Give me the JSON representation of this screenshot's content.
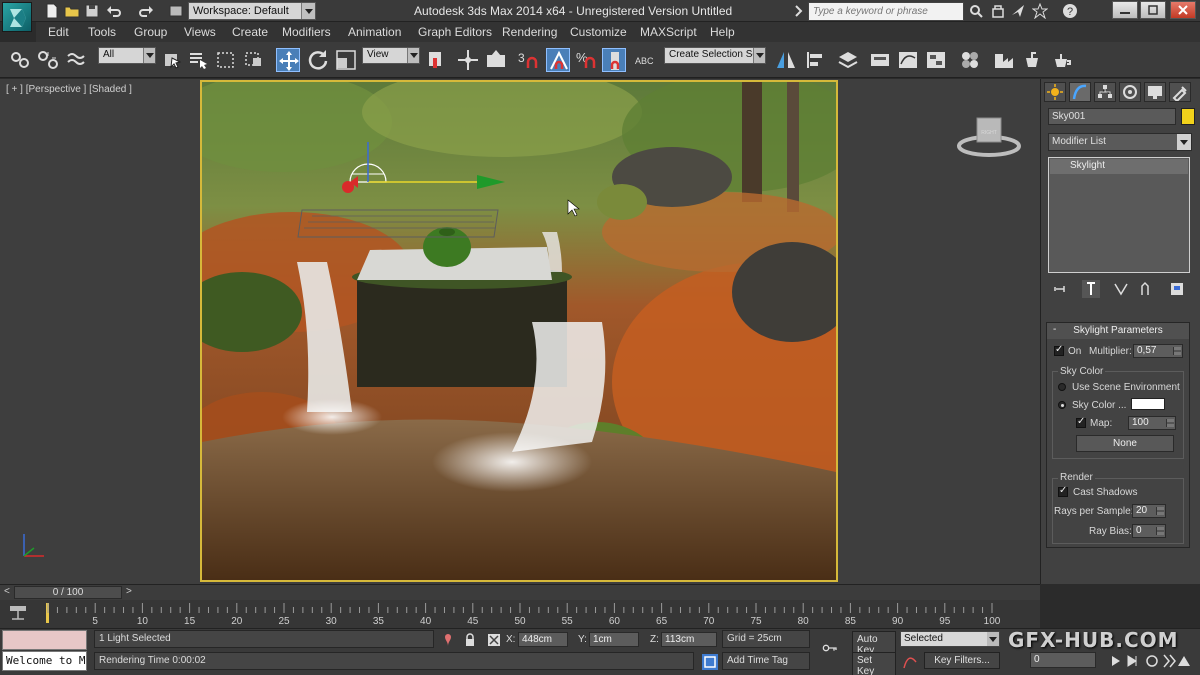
{
  "titlebar": {
    "workspace_label": "Workspace: Default",
    "window_title": "Autodesk 3ds Max  2014 x64   -   Unregistered Version    Untitled",
    "search_placeholder": "Type a keyword or phrase"
  },
  "menu": [
    "Edit",
    "Tools",
    "Group",
    "Views",
    "Create",
    "Modifiers",
    "Animation",
    "Graph Editors",
    "Rendering",
    "Customize",
    "MAXScript",
    "Help"
  ],
  "toolbar": {
    "selection_filter": "All",
    "reference_coord": "View",
    "selection_set_placeholder": "Create Selection Se",
    "snap_label": "3",
    "angle_snap_label": "%"
  },
  "viewport": {
    "label": "[ + ] [Perspective ] [Shaded ]",
    "viewcube_label": "RIGHT"
  },
  "command_panel": {
    "object_name": "Sky001",
    "modifier_list": "Modifier List",
    "stack_item": "Skylight",
    "rollout_title": "Skylight Parameters",
    "on_label": "On",
    "multiplier_label": "Multiplier:",
    "multiplier_value": "0,57",
    "sky_color_group": "Sky Color",
    "use_scene_env": "Use Scene Environment",
    "sky_color_label": "Sky Color ...",
    "map_label": "Map:",
    "map_value": "100",
    "none_button": "None",
    "render_group": "Render",
    "cast_shadows": "Cast Shadows",
    "rays_label": "Rays per Sample:",
    "rays_value": "20",
    "ray_bias_label": "Ray Bias:",
    "ray_bias_value": "0",
    "swatch_color": "#f2d21b"
  },
  "timeline": {
    "slider_label": "0 / 100",
    "ticks": [
      "0",
      "5",
      "10",
      "15",
      "20",
      "25",
      "30",
      "35",
      "40",
      "45",
      "50",
      "55",
      "60",
      "65",
      "70",
      "75",
      "80",
      "85",
      "90",
      "95",
      "100"
    ]
  },
  "status": {
    "maxscript_text": "Welcome to M",
    "selection": "1 Light Selected",
    "render_time": "Rendering Time  0:00:02",
    "x_label": "X:",
    "x_value": "448cm",
    "y_label": "Y:",
    "y_value": "1cm",
    "z_label": "Z:",
    "z_value": "113cm",
    "grid": "Grid = 25cm",
    "add_time_tag": "Add Time Tag",
    "auto_key": "Auto Key",
    "selected_dd": "Selected",
    "set_key": "Set Key",
    "key_filters": "Key Filters...",
    "frame_value": "0"
  },
  "watermark": "GFX-HUB.COM"
}
